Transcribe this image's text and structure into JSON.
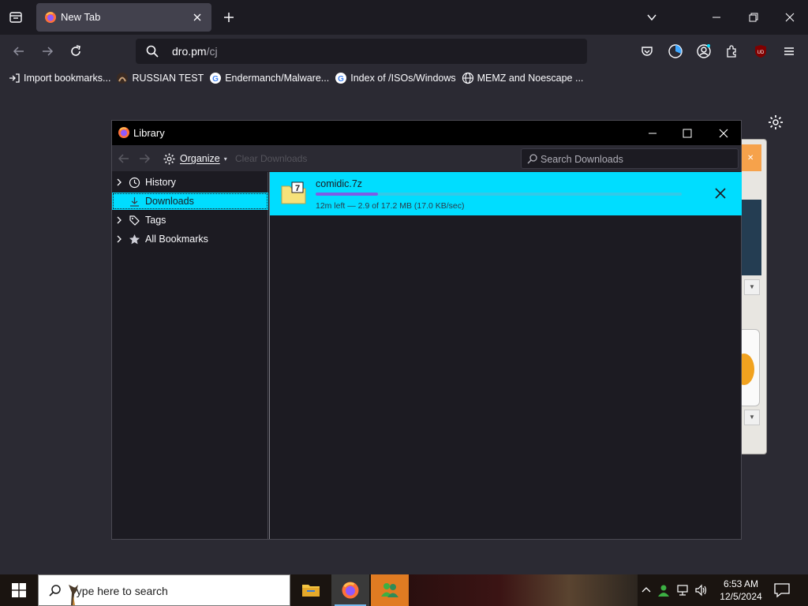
{
  "browser": {
    "tab_title": "New Tab",
    "url_host": "dro.pm",
    "url_path": "/cj"
  },
  "bookmarks": [
    {
      "label": "Import bookmarks...",
      "icon": "import-icon"
    },
    {
      "label": "RUSSIAN TEST",
      "icon": "avatar-icon"
    },
    {
      "label": "Endermanch/Malware...",
      "icon": "google-icon"
    },
    {
      "label": "Index of /ISOs/Windows",
      "icon": "google-icon"
    },
    {
      "label": "MEMZ and Noescape ...",
      "icon": "globe-icon"
    }
  ],
  "library": {
    "title": "Library",
    "organize_label": "Organize",
    "clear_label": "Clear Downloads",
    "search_placeholder": "Search Downloads",
    "sidebar": [
      {
        "label": "History",
        "icon": "clock-icon"
      },
      {
        "label": "Downloads",
        "icon": "download-icon"
      },
      {
        "label": "Tags",
        "icon": "tag-icon"
      },
      {
        "label": "All Bookmarks",
        "icon": "star-icon"
      }
    ],
    "download": {
      "filename": "comidic.7z",
      "status": "12m left — 2.9 of 17.2 MB (17.0 KB/sec)",
      "progress": 0.17
    }
  },
  "taskbar": {
    "search_placeholder": "Type here to search",
    "time": "6:53 AM",
    "date": "12/5/2024"
  },
  "colors": {
    "accent": "#00ddff",
    "progress_fill": "#7d5ce6",
    "chrome_dark": "#1c1b22",
    "chrome_mid": "#2b2a33"
  }
}
